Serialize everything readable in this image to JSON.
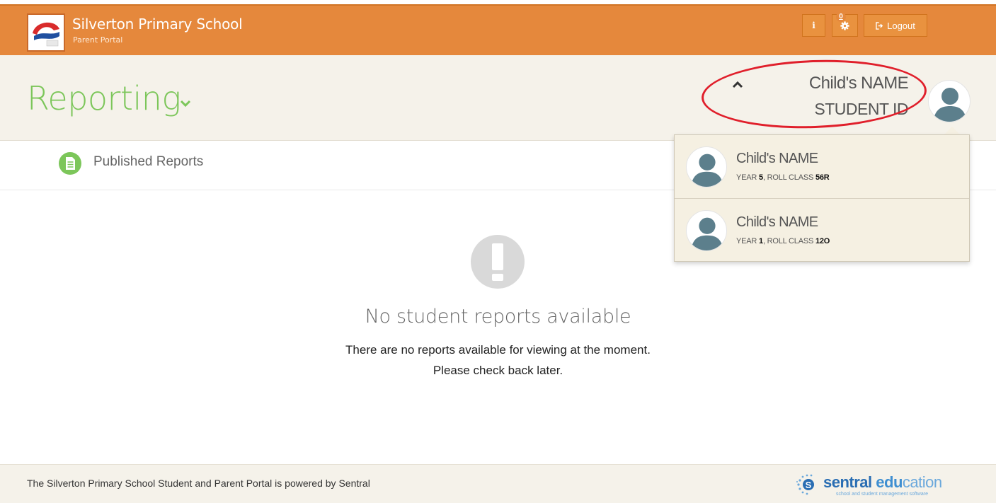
{
  "header": {
    "school_name": "Silverton Primary School",
    "portal_label": "Parent Portal",
    "info_label": "i",
    "notification_count": "0",
    "logout_label": "Logout",
    "accent_color": "#e5883c"
  },
  "page": {
    "title": "Reporting",
    "title_color": "#7cc65a"
  },
  "selected_child": {
    "name": "Child's NAME",
    "student_id": "STUDENT ID"
  },
  "tabs": [
    {
      "label": "Published Reports",
      "icon": "document-icon"
    }
  ],
  "child_menu": [
    {
      "name": "Child's NAME",
      "year_label": "YEAR",
      "year": "5",
      "class_label": ", ROLL CLASS",
      "class": "56R"
    },
    {
      "name": "Child's NAME",
      "year_label": "YEAR",
      "year": "1",
      "class_label": ", ROLL CLASS",
      "class": "12O"
    }
  ],
  "empty_state": {
    "icon": "exclamation-icon",
    "title": "No student reports available",
    "line1": "There are no reports available for viewing at the moment.",
    "line2": "Please check back later."
  },
  "footer": {
    "text": "The Silverton Primary School Student and Parent Portal is powered by Sentral",
    "brand_sentral": "sentral",
    "brand_edu": "edu",
    "brand_cation": "cation",
    "brand_tagline": "school and student management software"
  }
}
